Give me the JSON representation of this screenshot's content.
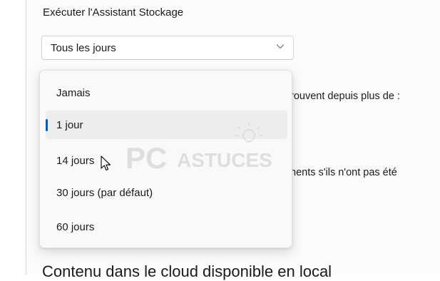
{
  "settings": {
    "section_label": "Exécuter l'Assistant Stockage",
    "combo_value": "Tous les jours",
    "bg_line_1": "rouvent depuis plus de :",
    "bg_line_2": "nents s'ils n'ont pas été",
    "next_heading": "Contenu dans le cloud disponible en local"
  },
  "dropdown": {
    "options": [
      {
        "label": "Jamais",
        "selected": false
      },
      {
        "label": "1 jour",
        "selected": true
      },
      {
        "label": "14 jours",
        "selected": false
      },
      {
        "label": "30 jours (par défaut)",
        "selected": false
      },
      {
        "label": "60 jours",
        "selected": false
      }
    ]
  },
  "watermark": {
    "brand_pc": "PC",
    "brand_name": "ASTUCES"
  },
  "colors": {
    "accent": "#005fb8",
    "selected_bg": "#ededed",
    "panel_bg": "#fbfbfb"
  },
  "icons": {
    "combo": "chevron-down-icon",
    "cursor": "mouse-pointer-icon",
    "watermark": "lightbulb-icon"
  }
}
